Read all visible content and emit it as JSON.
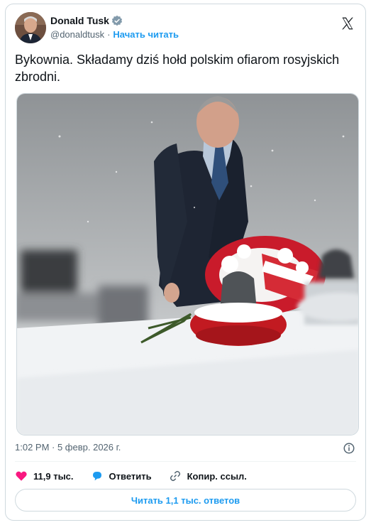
{
  "author": {
    "display_name": "Donald Tusk",
    "handle": "@donaldtusk",
    "separator": "·",
    "follow_label": "Начать читать"
  },
  "tweet": {
    "text": "Bykownia. Składamy dziś hołd polskim ofiarom rosyjskich zbrodni.",
    "timestamp": "1:02 PM · 5 февр. 2026 г."
  },
  "actions": {
    "likes": "11,9 тыс.",
    "reply_label": "Ответить",
    "copy_label": "Копир. ссыл."
  },
  "replies_button": "Читать 1,1 тыс. ответов",
  "colors": {
    "accent": "#1d9bf0",
    "like": "#f91880",
    "text_secondary": "#536471",
    "border": "#cfd9de"
  },
  "icons": [
    "verified-badge-icon",
    "x-logo-icon",
    "info-icon",
    "heart-icon",
    "reply-icon",
    "link-icon"
  ]
}
